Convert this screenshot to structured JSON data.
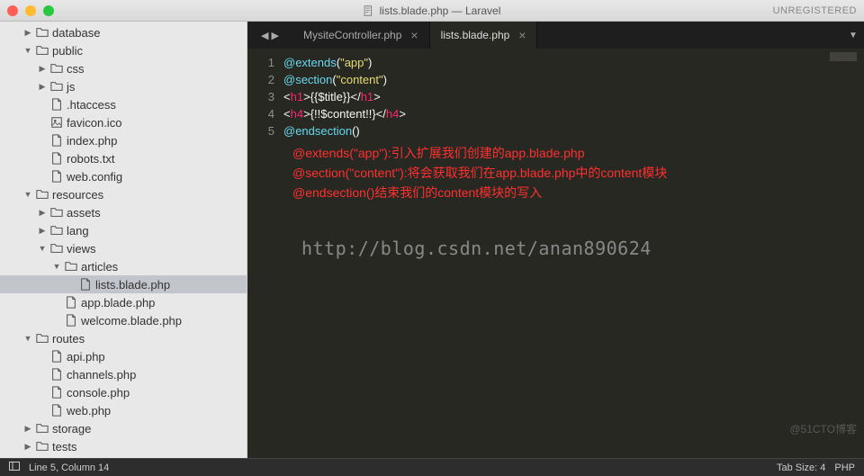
{
  "titlebar": {
    "title": "lists.blade.php — Laravel",
    "unregistered": "UNREGISTERED"
  },
  "sidebar": [
    {
      "d": 1,
      "a": "▶",
      "i": "folder",
      "l": "database"
    },
    {
      "d": 1,
      "a": "▼",
      "i": "folder",
      "l": "public"
    },
    {
      "d": 2,
      "a": "▶",
      "i": "folder",
      "l": "css"
    },
    {
      "d": 2,
      "a": "▶",
      "i": "folder",
      "l": "js"
    },
    {
      "d": 2,
      "a": "",
      "i": "file",
      "l": ".htaccess"
    },
    {
      "d": 2,
      "a": "",
      "i": "img",
      "l": "favicon.ico"
    },
    {
      "d": 2,
      "a": "",
      "i": "file",
      "l": "index.php"
    },
    {
      "d": 2,
      "a": "",
      "i": "file",
      "l": "robots.txt"
    },
    {
      "d": 2,
      "a": "",
      "i": "file",
      "l": "web.config"
    },
    {
      "d": 1,
      "a": "▼",
      "i": "folder",
      "l": "resources"
    },
    {
      "d": 2,
      "a": "▶",
      "i": "folder",
      "l": "assets"
    },
    {
      "d": 2,
      "a": "▶",
      "i": "folder",
      "l": "lang"
    },
    {
      "d": 2,
      "a": "▼",
      "i": "folder",
      "l": "views"
    },
    {
      "d": 3,
      "a": "▼",
      "i": "folder",
      "l": "articles"
    },
    {
      "d": 4,
      "a": "",
      "i": "file",
      "l": "lists.blade.php",
      "sel": true
    },
    {
      "d": 3,
      "a": "",
      "i": "file",
      "l": "app.blade.php"
    },
    {
      "d": 3,
      "a": "",
      "i": "file",
      "l": "welcome.blade.php"
    },
    {
      "d": 1,
      "a": "▼",
      "i": "folder",
      "l": "routes"
    },
    {
      "d": 2,
      "a": "",
      "i": "file",
      "l": "api.php"
    },
    {
      "d": 2,
      "a": "",
      "i": "file",
      "l": "channels.php"
    },
    {
      "d": 2,
      "a": "",
      "i": "file",
      "l": "console.php"
    },
    {
      "d": 2,
      "a": "",
      "i": "file",
      "l": "web.php"
    },
    {
      "d": 1,
      "a": "▶",
      "i": "folder",
      "l": "storage"
    },
    {
      "d": 1,
      "a": "▶",
      "i": "folder",
      "l": "tests"
    }
  ],
  "tabs": {
    "0": {
      "label": "MysiteController.php"
    },
    "1": {
      "label": "lists.blade.php"
    }
  },
  "code_lines": [
    "1",
    "2",
    "3",
    "4",
    "5"
  ],
  "annotations": {
    "l1": "@extends(\"app\"):引入扩展我们创建的app.blade.php",
    "l2": "@section(\"content\"):将会获取我们在app.blade.php中的content模块",
    "l3": "@endsection()结束我们的content模块的写入"
  },
  "watermark": "http://blog.csdn.net/anan890624",
  "corner": "@51CTO博客",
  "status": {
    "pos": "Line 5, Column 14",
    "tabsize": "Tab Size: 4",
    "lang": "PHP"
  }
}
